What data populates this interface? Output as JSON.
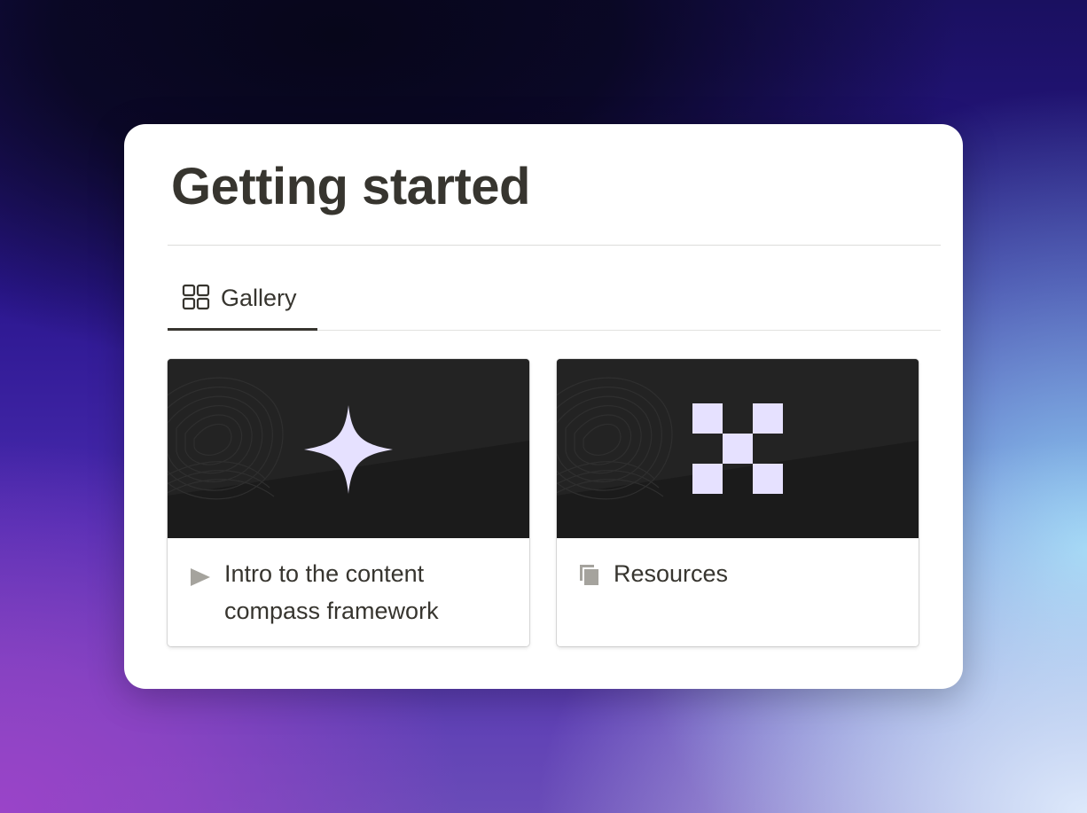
{
  "page": {
    "title": "Getting started"
  },
  "view_tabs": [
    {
      "label": "Gallery",
      "icon": "gallery-grid-icon",
      "active": true
    }
  ],
  "gallery": {
    "cards": [
      {
        "title": "Intro to the content compass framework",
        "icon": "play-triangle-icon",
        "cover_icon": "four-point-star-icon"
      },
      {
        "title": "Resources",
        "icon": "stacked-pages-icon",
        "cover_icon": "checker-x-icon"
      }
    ]
  },
  "colors": {
    "text": "#37352f",
    "cover_dark": "#1b1b1b",
    "cover_light": "#252525",
    "cover_accent": "#e6e1ff",
    "card_icon_gray": "#a5a39d"
  }
}
